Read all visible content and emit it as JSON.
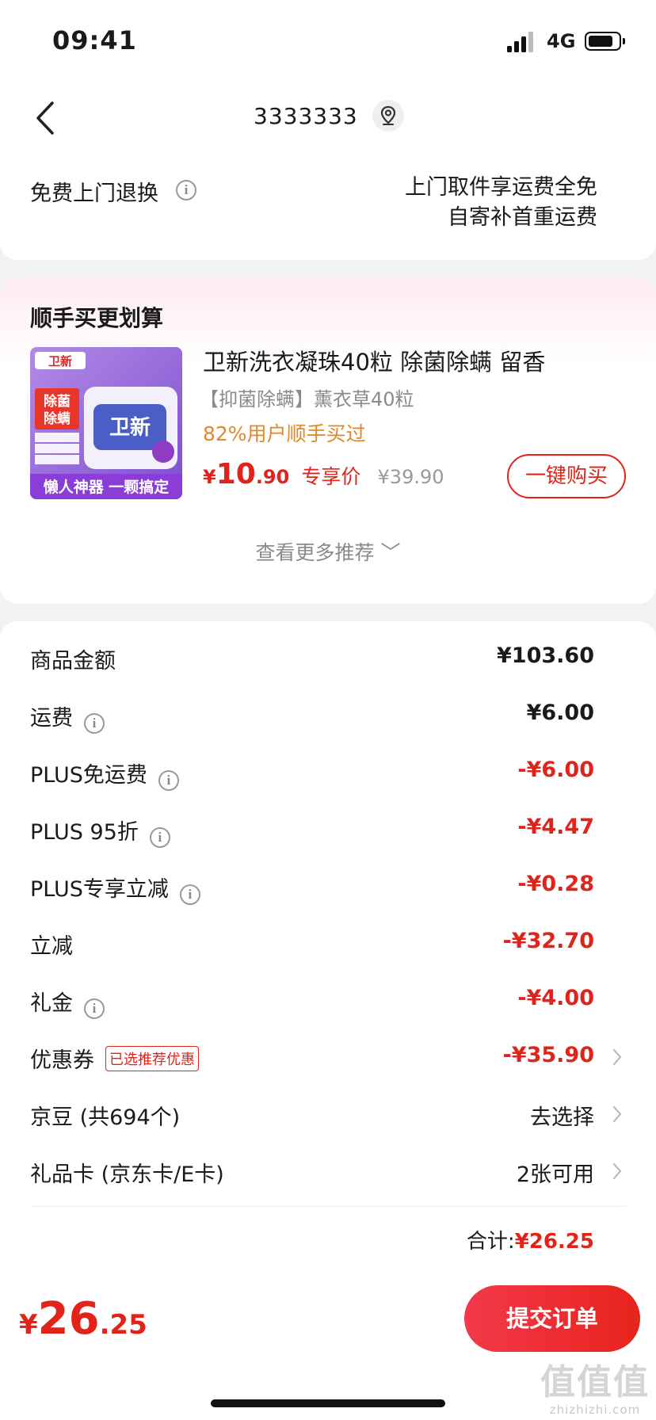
{
  "status_bar": {
    "time": "09:41",
    "network": "4G"
  },
  "header": {
    "address": "3333333",
    "return_label": "免费上门退换",
    "return_desc_1": "上门取件享运费全免",
    "return_desc_2": "自寄补首重运费"
  },
  "recommend": {
    "title": "顺手买更划算",
    "product": {
      "name": "卫新洗衣凝珠40粒 除菌除螨 留香",
      "spec": "【抑菌除螨】薰衣草40粒",
      "bought": "82%用户顺手买过",
      "price_symbol": "¥",
      "price_int": "10",
      "price_dec": ".90",
      "price_tag": "专享价",
      "orig_price": "¥39.90",
      "buy_label": "一键购买",
      "image_text": {
        "brand": "卫新",
        "badge": "除菌\n除螨",
        "slogan": "懒人神器 一颗搞定"
      }
    },
    "more_label": "查看更多推荐 ﹀"
  },
  "bill": {
    "rows": [
      {
        "label": "商品金额",
        "value": "¥103.60"
      },
      {
        "label": "运费",
        "value": "¥6.00"
      },
      {
        "label": "PLUS免运费",
        "value": "-¥6.00"
      },
      {
        "label": "PLUS 95折",
        "value": "-¥4.47"
      },
      {
        "label": "PLUS专享立减",
        "value": "-¥0.28"
      },
      {
        "label": "立减",
        "value": "-¥32.70"
      },
      {
        "label": "礼金",
        "value": "-¥4.00"
      },
      {
        "label": "优惠券",
        "tag": "已选推荐优惠",
        "value": "-¥35.90"
      },
      {
        "label": "京豆 (共694个)",
        "value": "去选择"
      },
      {
        "label": "礼品卡 (京东卡/E卡)",
        "value": "2张可用"
      }
    ],
    "total_label": "合计:",
    "total_value": "¥26.25"
  },
  "footer": {
    "price_symbol": "¥",
    "price_int": "26",
    "price_dec": ".25",
    "submit_label": "提交订单",
    "watermark_url": "zhizhizhi.com"
  },
  "colors": {
    "accent": "#e2231a",
    "orange": "#e0882b",
    "muted": "#8a8a8a"
  }
}
